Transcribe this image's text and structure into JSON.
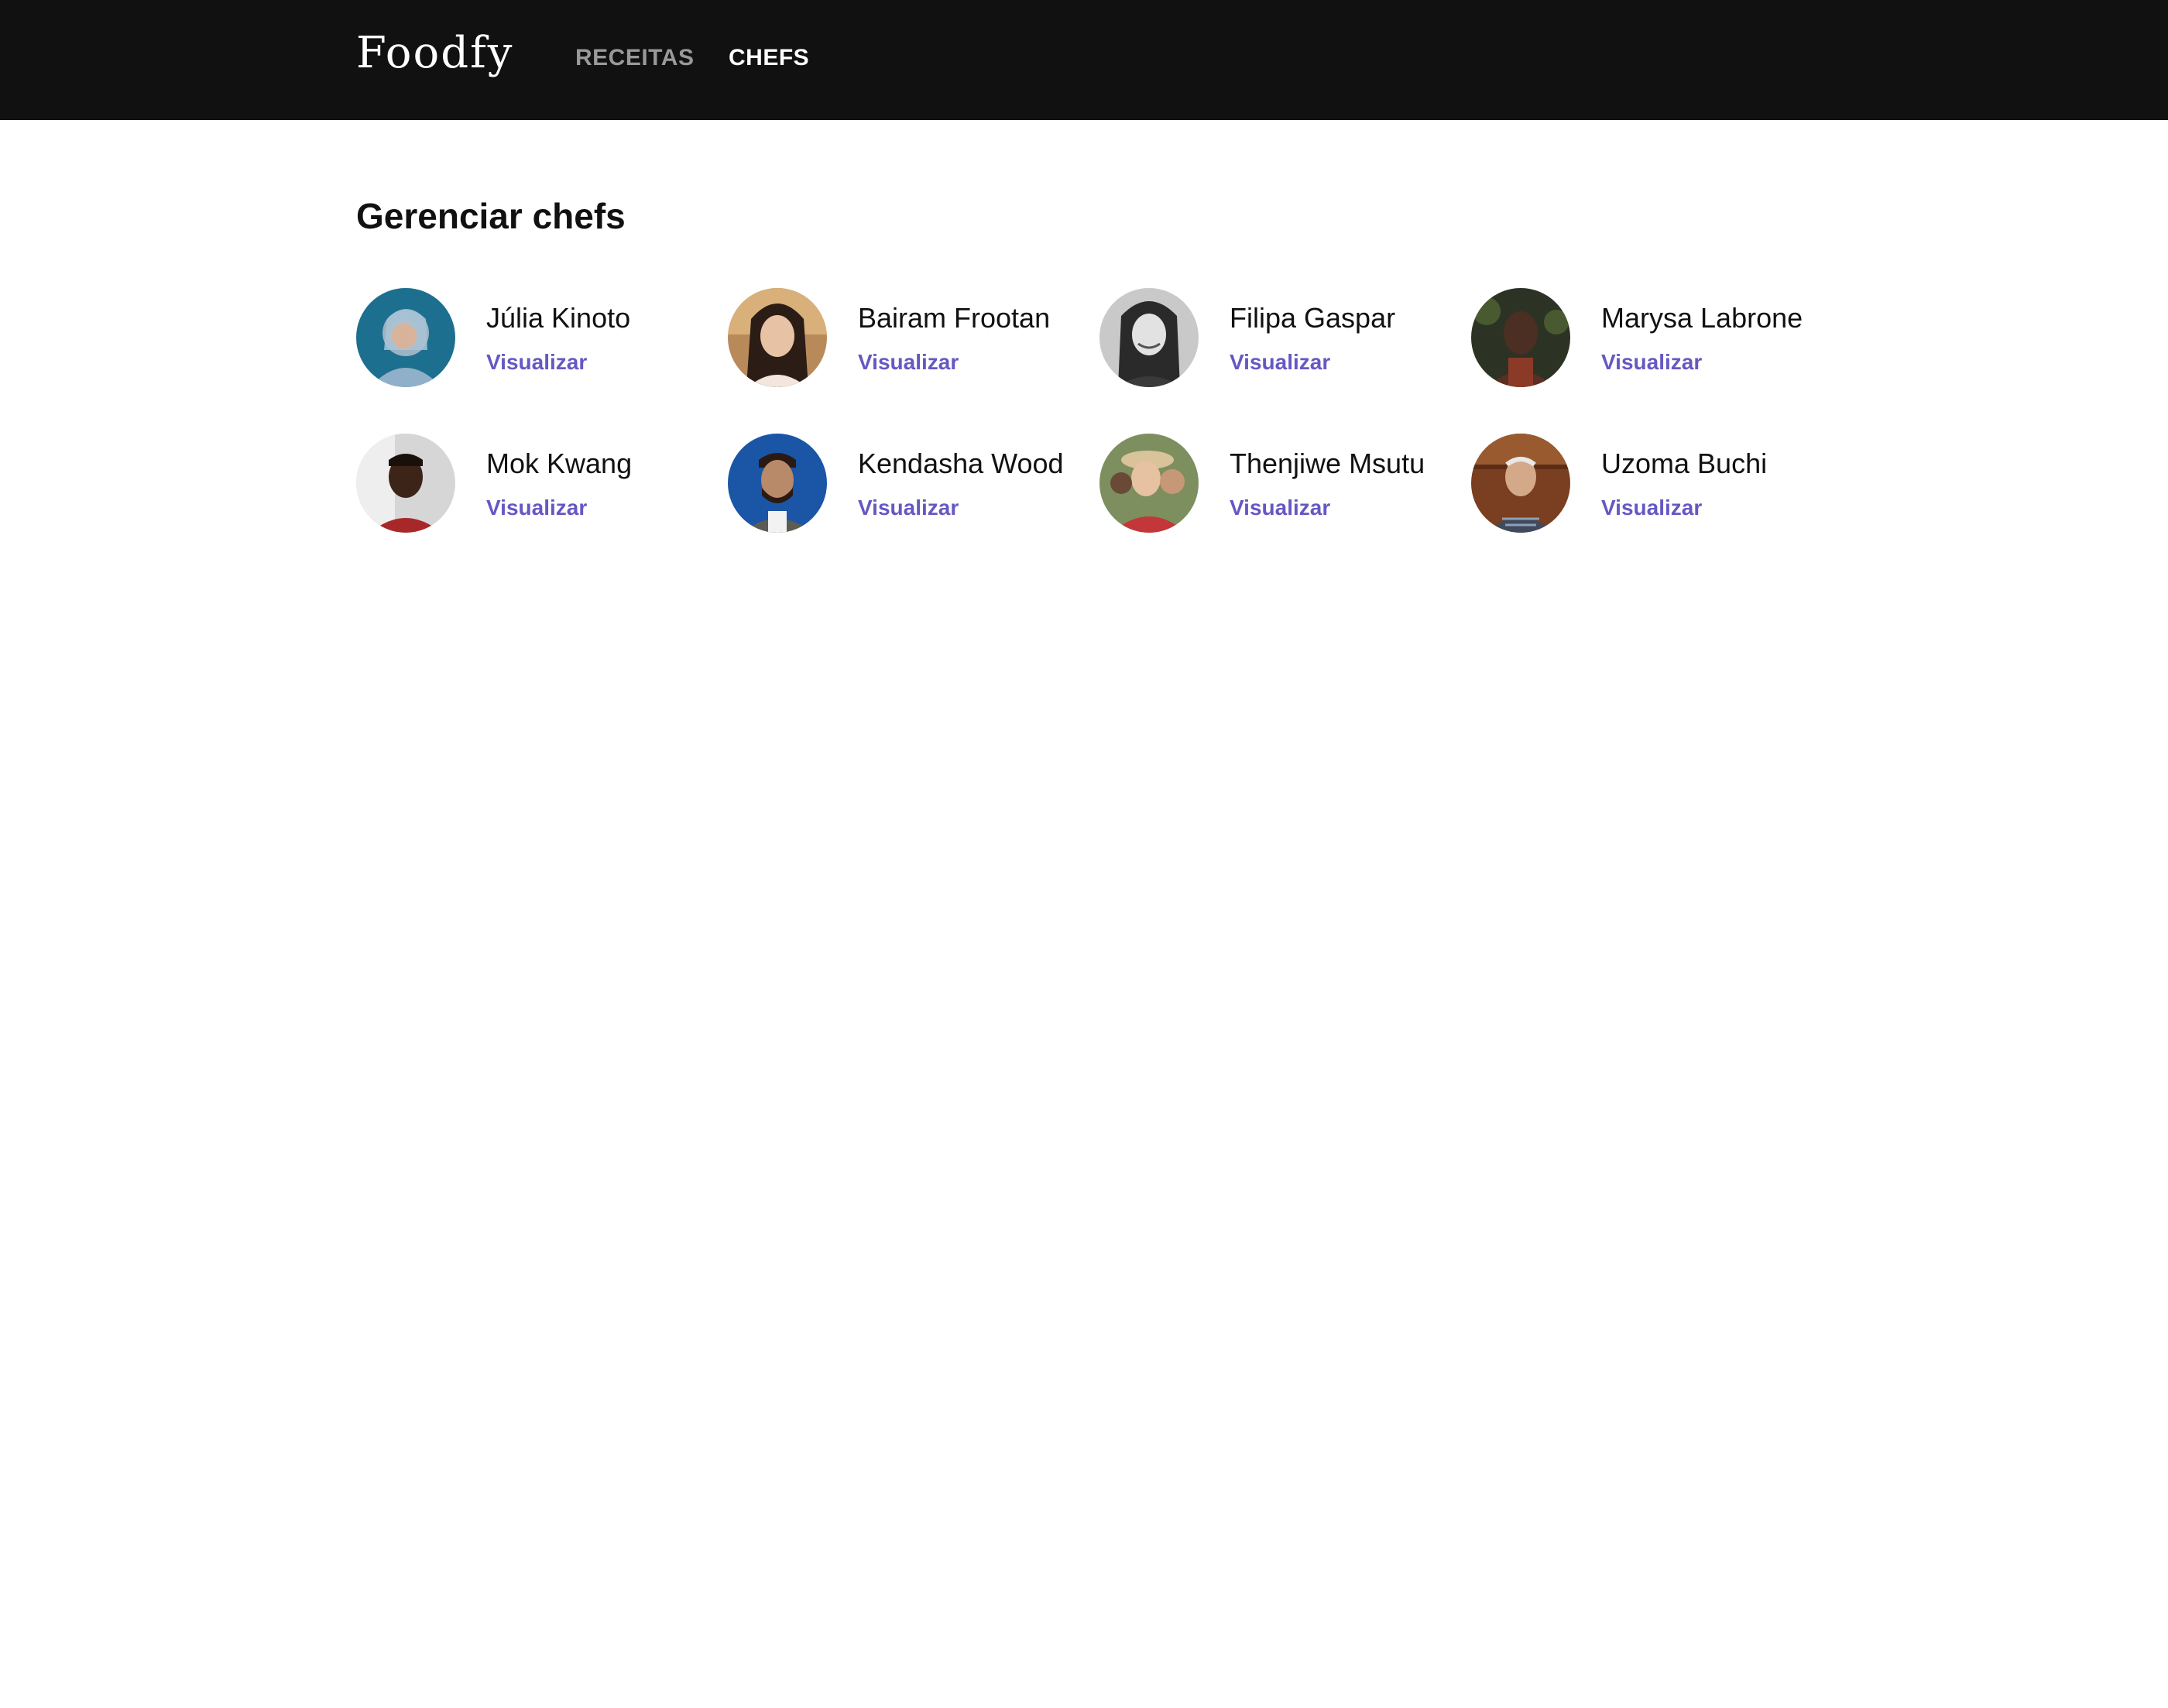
{
  "header": {
    "logo": "Foodfy",
    "nav": [
      {
        "label": "RECEITAS"
      },
      {
        "label": "CHEFS"
      }
    ]
  },
  "page": {
    "title": "Gerenciar chefs"
  },
  "colors": {
    "header_bg": "#111111",
    "nav_inactive": "#999999",
    "nav_active": "#ffffff",
    "link": "#6558c3"
  },
  "chefs": [
    {
      "name": "Júlia Kinoto",
      "link": "Visualizar",
      "avatar_icon": "chef-photo"
    },
    {
      "name": "Bairam Frootan",
      "link": "Visualizar",
      "avatar_icon": "chef-photo"
    },
    {
      "name": "Filipa Gaspar",
      "link": "Visualizar",
      "avatar_icon": "chef-photo"
    },
    {
      "name": "Marysa Labrone",
      "link": "Visualizar",
      "avatar_icon": "chef-photo"
    },
    {
      "name": "Mok Kwang",
      "link": "Visualizar",
      "avatar_icon": "chef-photo"
    },
    {
      "name": "Kendasha Wood",
      "link": "Visualizar",
      "avatar_icon": "chef-photo"
    },
    {
      "name": "Thenjiwe Msutu",
      "link": "Visualizar",
      "avatar_icon": "chef-photo"
    },
    {
      "name": "Uzoma Buchi",
      "link": "Visualizar",
      "avatar_icon": "chef-photo"
    }
  ]
}
